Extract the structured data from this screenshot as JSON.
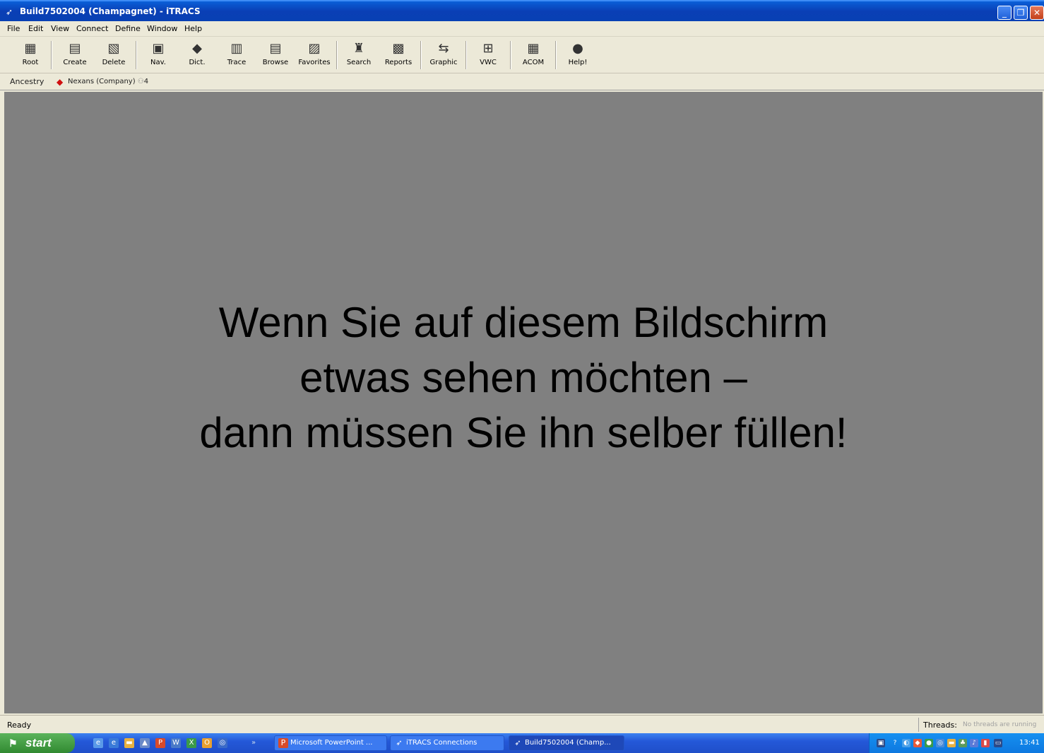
{
  "window": {
    "title": "Build7502004 (Champagnet) - iTRACS",
    "minimize_label": "_",
    "restore_label": "❐",
    "close_label": "✕"
  },
  "menu": [
    "File",
    "Edit",
    "View",
    "Connect",
    "Define",
    "Window",
    "Help"
  ],
  "toolbar": [
    {
      "label": "Root",
      "icon": "root-icon",
      "glyph": "▦"
    },
    {
      "label": "Create",
      "icon": "create-icon",
      "glyph": "▤"
    },
    {
      "label": "Delete",
      "icon": "delete-icon",
      "glyph": "▧"
    },
    {
      "label": "Nav.",
      "icon": "navigate-icon",
      "glyph": "▣"
    },
    {
      "label": "Dict.",
      "icon": "dictionary-icon",
      "glyph": "◆"
    },
    {
      "label": "Trace",
      "icon": "trace-icon",
      "glyph": "▥"
    },
    {
      "label": "Browse",
      "icon": "browse-icon",
      "glyph": "▤"
    },
    {
      "label": "Favorites",
      "icon": "favorites-icon",
      "glyph": "▨"
    },
    {
      "label": "Search",
      "icon": "search-icon",
      "glyph": "♜"
    },
    {
      "label": "Reports",
      "icon": "reports-icon",
      "glyph": "▩"
    },
    {
      "label": "Graphic",
      "icon": "graphic-icon",
      "glyph": "⇆"
    },
    {
      "label": "VWC",
      "icon": "vwc-icon",
      "glyph": "⊞"
    },
    {
      "label": "ACOM",
      "icon": "acom-icon",
      "glyph": "▦"
    },
    {
      "label": "Help!",
      "icon": "help-icon",
      "glyph": "●"
    }
  ],
  "ancestry": {
    "label": "Ancestry",
    "item": "Nexans (Company)",
    "count": "4"
  },
  "overlay": {
    "line1": "Wenn Sie auf diesem Bildschirm",
    "line2": "etwas sehen möchten –",
    "line3": "dann müssen Sie ihn selber füllen!"
  },
  "status": {
    "text": "Ready",
    "threads_label": "Threads:",
    "threads_value": "No threads are running"
  },
  "taskbar": {
    "start_label": "start",
    "tasks": [
      {
        "label": "Microsoft PowerPoint ...",
        "icon": "powerpoint-icon"
      },
      {
        "label": "iTRACS Connections",
        "icon": "itracs-icon"
      },
      {
        "label": "Build7502004 (Champ...",
        "icon": "itracs-icon"
      }
    ],
    "clock": "13:41"
  },
  "colors": {
    "workspace": "#808080",
    "titlebar": "#0a4fd0",
    "start_button": "#3a9a3a",
    "taskbar": "#245edb"
  }
}
